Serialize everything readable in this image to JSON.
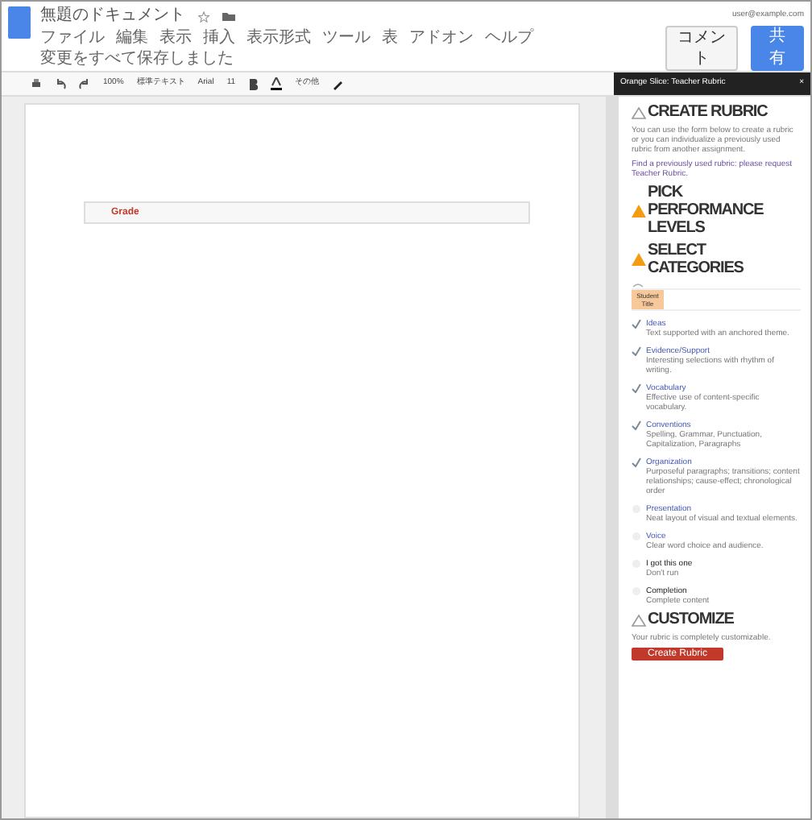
{
  "app": {
    "title": "無題のドキュメント",
    "account": "user@example.com",
    "comment_button": "コメント",
    "share_button": "共有",
    "menus": [
      "ファイル",
      "編集",
      "表示",
      "挿入",
      "表示形式",
      "ツール",
      "表",
      "アドオン",
      "ヘルプ"
    ],
    "save_status": "変更をすべて保存しました"
  },
  "toolbar": {
    "zoom": "100%",
    "style": "標準テキスト",
    "font": "Arial",
    "size": "11",
    "more": "その他"
  },
  "document": {
    "table_label": "Grade"
  },
  "sidebar": {
    "title": "Orange Slice: Teacher Rubric",
    "close": "×",
    "create_heading": "CREATE RUBRIC",
    "create_text": "You can use the form below to create a rubric or you can individualize a previously used rubric from another assignment.",
    "find_text": "Find a previously used rubric: please request Teacher Rubric.",
    "levels_heading": "PICK PERFORMANCE LEVELS",
    "categories_heading": "SELECT CATEGORIES",
    "preview_header": "Student Title",
    "categories": [
      {
        "title": "Ideas",
        "text": "Text supported with an anchored theme.",
        "checked": true,
        "custom": false
      },
      {
        "title": "Evidence/Support",
        "text": "Interesting selections with rhythm of writing.",
        "checked": true,
        "custom": false
      },
      {
        "title": "Vocabulary",
        "text": "Effective use of content-specific vocabulary.",
        "checked": true,
        "custom": false
      },
      {
        "title": "Conventions",
        "text": "Spelling, Grammar, Punctuation, Capitalization, Paragraphs",
        "checked": true,
        "custom": false
      },
      {
        "title": "Organization",
        "text": "Purposeful paragraphs; transitions; content relationships; cause-effect; chronological order",
        "checked": true,
        "custom": false
      },
      {
        "title": "Presentation",
        "text": "Neat layout of visual and textual elements.",
        "checked": false,
        "custom": false
      },
      {
        "title": "Voice",
        "text": "Clear word choice and audience.",
        "checked": false,
        "custom": false
      },
      {
        "title": "I got this one",
        "text": "Don't run",
        "checked": false,
        "custom": true
      },
      {
        "title": "Completion",
        "text": "Complete content",
        "checked": false,
        "custom": true
      }
    ],
    "customize_heading": "CUSTOMIZE",
    "customize_text": "Your rubric is completely customizable.",
    "create_button": "Create Rubric"
  }
}
